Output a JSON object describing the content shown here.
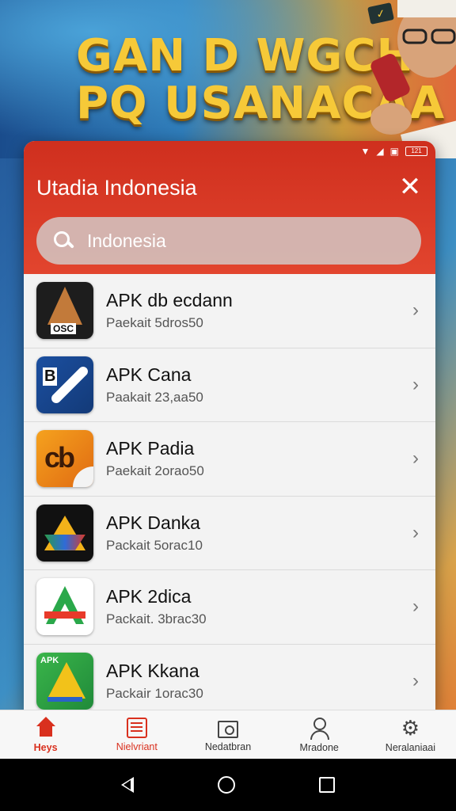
{
  "banner": {
    "headline_line1": "GAN D WGCH",
    "headline_line2": "PQ USANACΛA"
  },
  "status_bar": {
    "battery_text": "121"
  },
  "dialog": {
    "title": "Utadia Indonesia",
    "close_symbol": "✕",
    "search": {
      "value": "Indonesia",
      "placeholder": "Indonesia"
    }
  },
  "apps": [
    {
      "title": "APK db ecdann",
      "subtitle": "Paekait 5dros50",
      "icon": "apk-a-icon",
      "icon_label": "OSC"
    },
    {
      "title": "APK Cana",
      "subtitle": "Paakait 23,aa50",
      "icon": "apk-stick-icon",
      "icon_label": "B"
    },
    {
      "title": "APK Padia",
      "subtitle": "Paekait 2orao50",
      "icon": "apk-cb-icon",
      "icon_label": "cb"
    },
    {
      "title": "APK Danka",
      "subtitle": "Packait 5orac10",
      "icon": "apk-drive-icon",
      "icon_label": ""
    },
    {
      "title": "APK 2dica",
      "subtitle": "Packait. 3brac30",
      "icon": "apk-a-red-icon",
      "icon_label": ""
    },
    {
      "title": "APK Kkana",
      "subtitle": "Packair 1orac30",
      "icon": "apk-green-icon",
      "icon_label": "APK"
    }
  ],
  "chevron_symbol": "›",
  "bottom_nav": {
    "items": [
      {
        "label": "Heys",
        "icon": "home-icon",
        "active": true
      },
      {
        "label": "Nielvriant",
        "icon": "news-icon",
        "active": false
      },
      {
        "label": "Nedatbran",
        "icon": "camera-icon",
        "active": false
      },
      {
        "label": "Mradone",
        "icon": "profile-icon",
        "active": false
      },
      {
        "label": "Neralaniaai",
        "icon": "gear-icon",
        "active": false
      }
    ]
  },
  "colors": {
    "accent": "#d9301e",
    "header_red": "#e2452e",
    "headline_gold": "#f6c938"
  }
}
